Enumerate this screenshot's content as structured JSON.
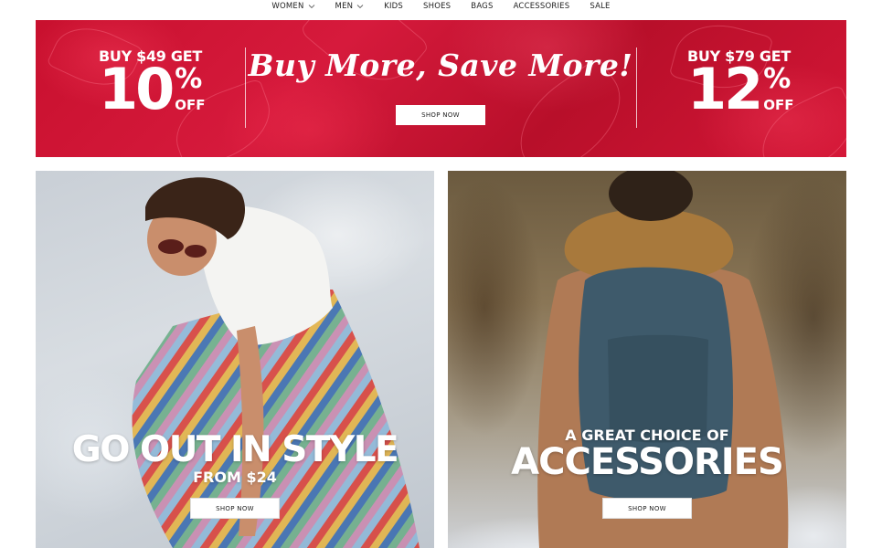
{
  "nav": {
    "items": [
      {
        "label": "WOMEN",
        "has_dropdown": true
      },
      {
        "label": "MEN",
        "has_dropdown": true
      },
      {
        "label": "KIDS",
        "has_dropdown": false
      },
      {
        "label": "SHOES",
        "has_dropdown": false
      },
      {
        "label": "BAGS",
        "has_dropdown": false
      },
      {
        "label": "ACCESSORIES",
        "has_dropdown": false
      },
      {
        "label": "SALE",
        "has_dropdown": false
      }
    ]
  },
  "banner": {
    "left_deal": {
      "top": "BUY $49 GET",
      "number": "10",
      "percent": "%",
      "off": "OFF"
    },
    "headline": "Buy More, Save More!",
    "button": "SHOP NOW",
    "right_deal": {
      "top": "BUY $79 GET",
      "number": "12",
      "percent": "%",
      "off": "OFF"
    },
    "colors": {
      "background": "#c8102e",
      "text": "#ffffff"
    }
  },
  "panels": {
    "left": {
      "title": "GO OUT IN STYLE",
      "subtitle": "FROM $24",
      "button": "SHOP NOW"
    },
    "right": {
      "kicker": "A GREAT CHOICE OF",
      "title": "ACCESSORIES",
      "button": "SHOP NOW"
    }
  }
}
